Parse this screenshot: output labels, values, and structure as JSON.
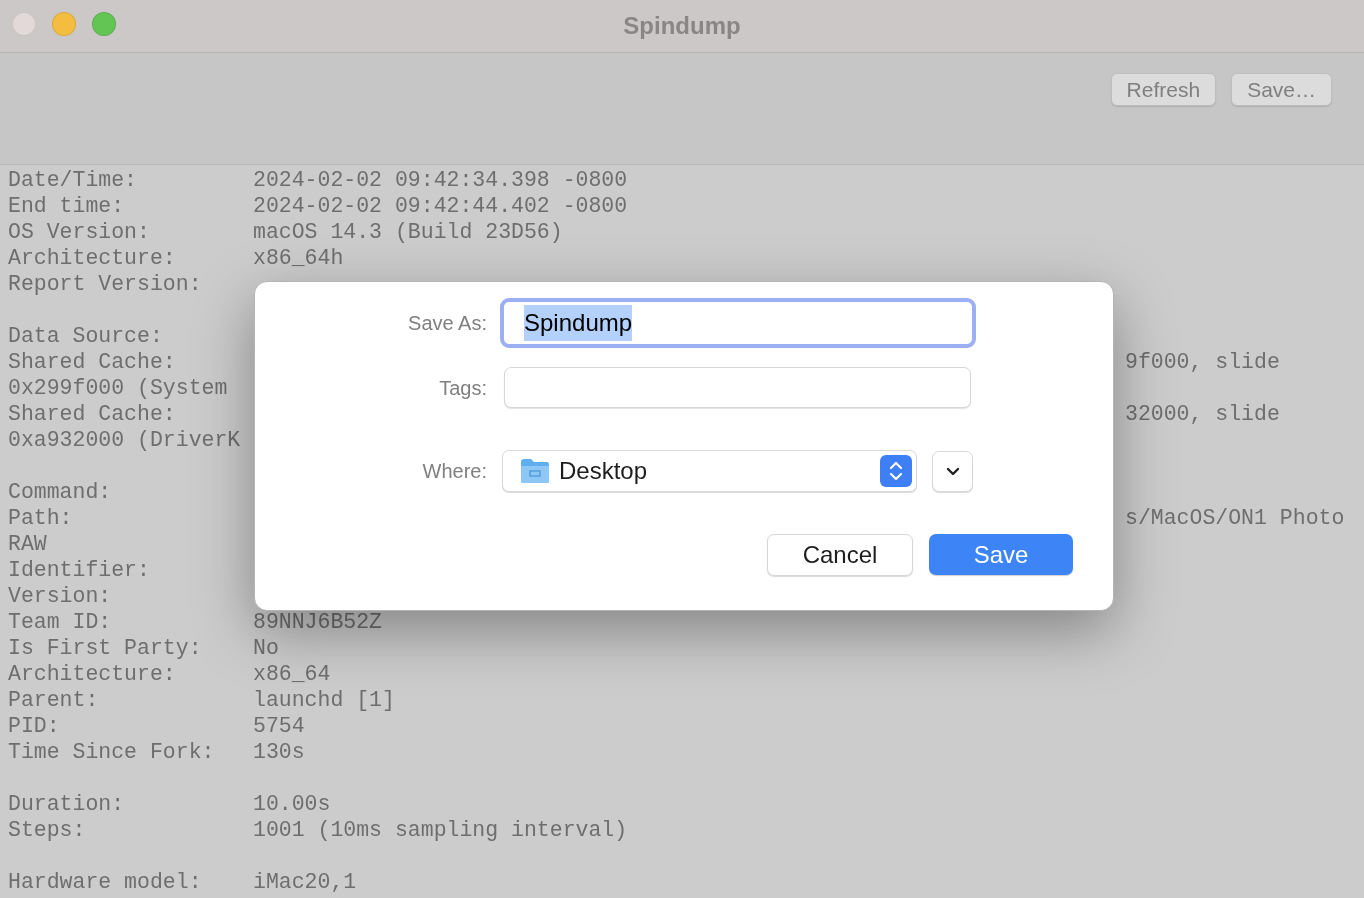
{
  "window": {
    "title": "Spindump",
    "controls": [
      {
        "color": "#e3d9d9"
      },
      {
        "color": "#f5bd40"
      },
      {
        "color": "#62c554"
      }
    ]
  },
  "toolbar": {
    "buttons": [
      "Refresh",
      "Save…"
    ]
  },
  "report": {
    "lines": [
      {
        "kind": "field",
        "label": "Date/Time:",
        "value": "2024-02-02 09:42:34.398 -0800"
      },
      {
        "kind": "field",
        "label": "End time:",
        "value": "2024-02-02 09:42:44.402 -0800"
      },
      {
        "kind": "field",
        "label": "OS Version:",
        "value": "macOS 14.3 (Build 23D56)"
      },
      {
        "kind": "field",
        "label": "Architecture:",
        "value": "x86_64h"
      },
      {
        "kind": "field",
        "label": "Report Version:"
      },
      {
        "kind": "blank"
      },
      {
        "kind": "field",
        "label": "Data Source:"
      },
      {
        "kind": "field",
        "label": "Shared Cache:",
        "tail": "9f000, slide"
      },
      {
        "kind": "text",
        "text": "0x299f000 (System"
      },
      {
        "kind": "field",
        "label": "Shared Cache:",
        "tail": "32000, slide"
      },
      {
        "kind": "text",
        "text": "0xa932000 (DriverK"
      },
      {
        "kind": "blank"
      },
      {
        "kind": "field",
        "label": "Command:"
      },
      {
        "kind": "field",
        "label": "Path:",
        "tail": "s/MacOS/ON1 Photo"
      },
      {
        "kind": "text",
        "text": "RAW"
      },
      {
        "kind": "field",
        "label": "Identifier:"
      },
      {
        "kind": "field",
        "label": "Version:"
      },
      {
        "kind": "field",
        "label": "Team ID:",
        "value": "89NNJ6B52Z"
      },
      {
        "kind": "field",
        "label": "Is First Party:",
        "value": "No"
      },
      {
        "kind": "field",
        "label": "Architecture:",
        "value": "x86_64"
      },
      {
        "kind": "field",
        "label": "Parent:",
        "value": "launchd [1]"
      },
      {
        "kind": "field",
        "label": "PID:",
        "value": "5754"
      },
      {
        "kind": "field",
        "label": "Time Since Fork:",
        "value": "130s"
      },
      {
        "kind": "blank"
      },
      {
        "kind": "field",
        "label": "Duration:",
        "value": "10.00s"
      },
      {
        "kind": "field",
        "label": "Steps:",
        "value": "1001 (10ms sampling interval)"
      },
      {
        "kind": "blank"
      },
      {
        "kind": "field",
        "label": "Hardware model:",
        "value": "iMac20,1"
      }
    ]
  },
  "save_dialog": {
    "save_as": {
      "label": "Save As:",
      "value": "Spindump",
      "text_selected": true
    },
    "tags": {
      "label": "Tags:"
    },
    "where": {
      "label": "Where:",
      "value": "Desktop"
    },
    "buttons": [
      {
        "label": "Cancel",
        "default": false
      },
      {
        "label": "Save",
        "default": true
      }
    ]
  }
}
